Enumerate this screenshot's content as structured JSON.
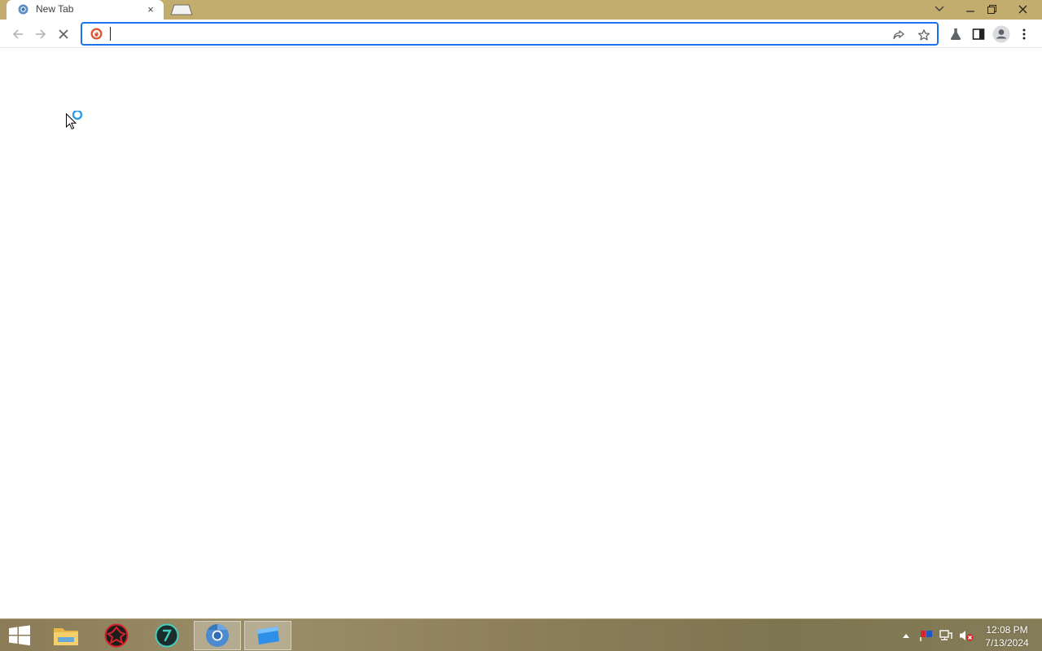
{
  "browser": {
    "tab": {
      "title": "New Tab",
      "close_symbol": "×"
    },
    "omnibox": {
      "value": "",
      "placeholder": ""
    },
    "page_state": "loading"
  },
  "colors": {
    "titlebar": "#c2ad6f",
    "focus_ring": "#1a73e8",
    "cursor_spinner": "#2f9be3"
  },
  "icons": {
    "tab_favicon": "chromium-favicon-icon",
    "back": "back-arrow-icon",
    "forward": "forward-arrow-icon",
    "stop": "stop-icon",
    "site_info": "duckduckgo-icon",
    "share": "share-icon",
    "bookmark": "star-icon",
    "labs": "flask-icon",
    "side_panel": "side-panel-icon",
    "profile": "profile-avatar-icon",
    "menu": "kebab-menu-icon"
  },
  "taskbar": {
    "apps": [
      {
        "name": "File Explorer",
        "icon": "file-explorer-icon",
        "active": false
      },
      {
        "name": "Red shield app",
        "icon": "red-shield-icon",
        "active": false
      },
      {
        "name": "Green clock app",
        "icon": "green-circle-icon",
        "active": false
      },
      {
        "name": "Chromium",
        "icon": "chromium-icon",
        "active": true
      },
      {
        "name": "Blue window app",
        "icon": "blue-window-icon",
        "active": true
      }
    ],
    "clock": {
      "time": "12:08 PM",
      "date": "7/13/2024"
    }
  }
}
